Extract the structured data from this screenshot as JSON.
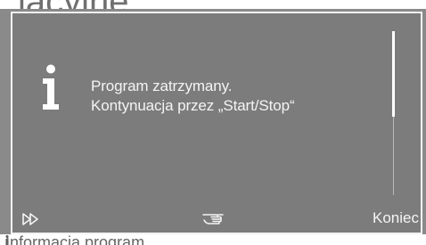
{
  "background": {
    "title_fragment": "lacyjne"
  },
  "dialog": {
    "icon": "info-icon",
    "message_line1": "Program zatrzymany.",
    "message_line2": "Kontynuacja przez „Start/Stop“"
  },
  "toolbar": {
    "fast_forward_icon": "fast-forward-icon",
    "hand_icon": "hand-pointer-icon",
    "end_label": "Koniec"
  },
  "footer": {
    "text": "Informacja program."
  },
  "colors": {
    "screen": "#8a8a8a",
    "dialog": "#7c7c7c",
    "text": "#f4f4f4"
  }
}
